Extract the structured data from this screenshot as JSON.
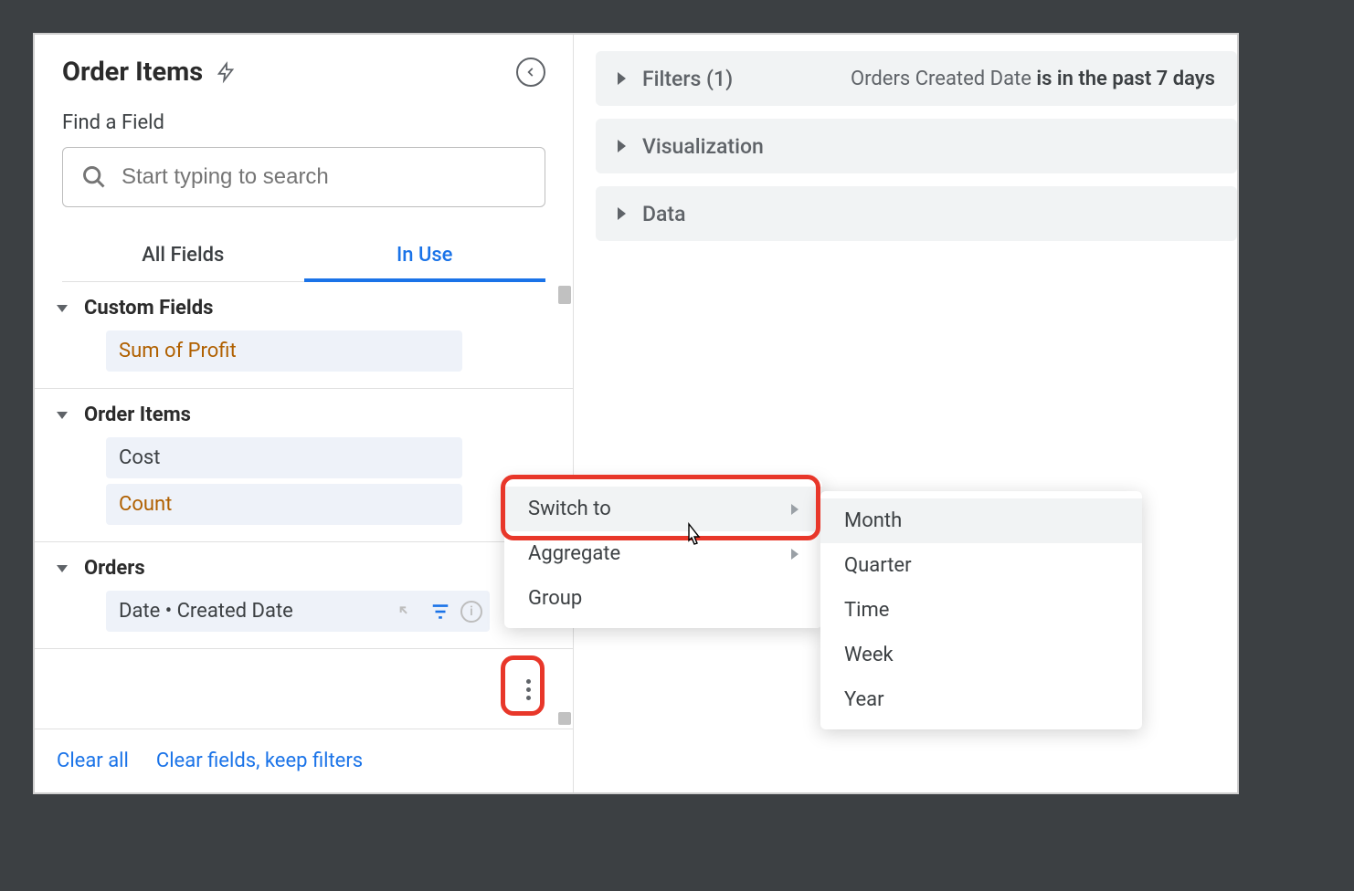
{
  "panel": {
    "title": "Order Items",
    "find_label": "Find a Field",
    "search_placeholder": "Start typing to search",
    "tabs": {
      "all": "All Fields",
      "inuse": "In Use"
    }
  },
  "sections": [
    {
      "name": "Custom Fields",
      "items": [
        {
          "label": "Sum of Profit",
          "kind": "measure"
        }
      ]
    },
    {
      "name": "Order Items",
      "items": [
        {
          "label": "Cost",
          "kind": "dim"
        },
        {
          "label": "Count",
          "kind": "measure"
        }
      ]
    },
    {
      "name": "Orders",
      "items": [
        {
          "label": "Date • Created Date",
          "kind": "dim",
          "hasActions": true
        }
      ]
    }
  ],
  "footer": {
    "clear_all": "Clear all",
    "clear_fields": "Clear fields, keep filters"
  },
  "bars": {
    "filters": {
      "label": "Filters (1)",
      "desc_prefix": "Orders Created Date ",
      "desc_bold": "is in the past 7 days"
    },
    "viz": {
      "label": "Visualization"
    },
    "data": {
      "label": "Data"
    }
  },
  "menu1": [
    {
      "label": "Switch to",
      "submenu": true,
      "hover": true
    },
    {
      "label": "Aggregate",
      "submenu": true
    },
    {
      "label": "Group"
    }
  ],
  "menu2": [
    {
      "label": "Month",
      "hover": true
    },
    {
      "label": "Quarter"
    },
    {
      "label": "Time"
    },
    {
      "label": "Week"
    },
    {
      "label": "Year"
    }
  ]
}
